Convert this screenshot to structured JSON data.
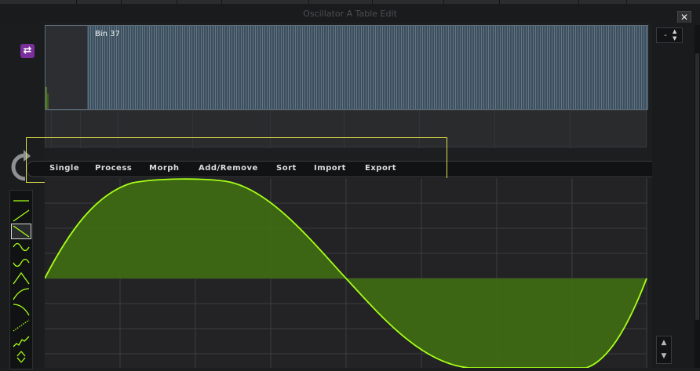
{
  "window": {
    "title": "Oscillator A Table Edit",
    "close_label": "✕"
  },
  "bin_display": {
    "label": "Bin 37"
  },
  "menu": {
    "items": [
      "Single",
      "Process",
      "Morph",
      "Add/Remove",
      "Sort",
      "Import",
      "Export"
    ]
  },
  "side_controls": {
    "bin_select_value": "-",
    "bin_select_arrows": "▲▼",
    "spinner_up": "▲",
    "spinner_down": "▼",
    "loop_icon": "⇄"
  },
  "colors": {
    "wave_line": "#a6ff17",
    "wave_fill": "#3e6a12",
    "bin_bg": "#3d4e5c",
    "highlight": "#e0e04a",
    "loop_toggle": "#7a2f9c"
  },
  "shape_presets": [
    "flat",
    "ramp-up",
    "ramp-down",
    "sine",
    "sine-inverted",
    "triangle",
    "ramp-curve",
    "step",
    "dotted-ramp",
    "random-noise",
    "up-down"
  ]
}
